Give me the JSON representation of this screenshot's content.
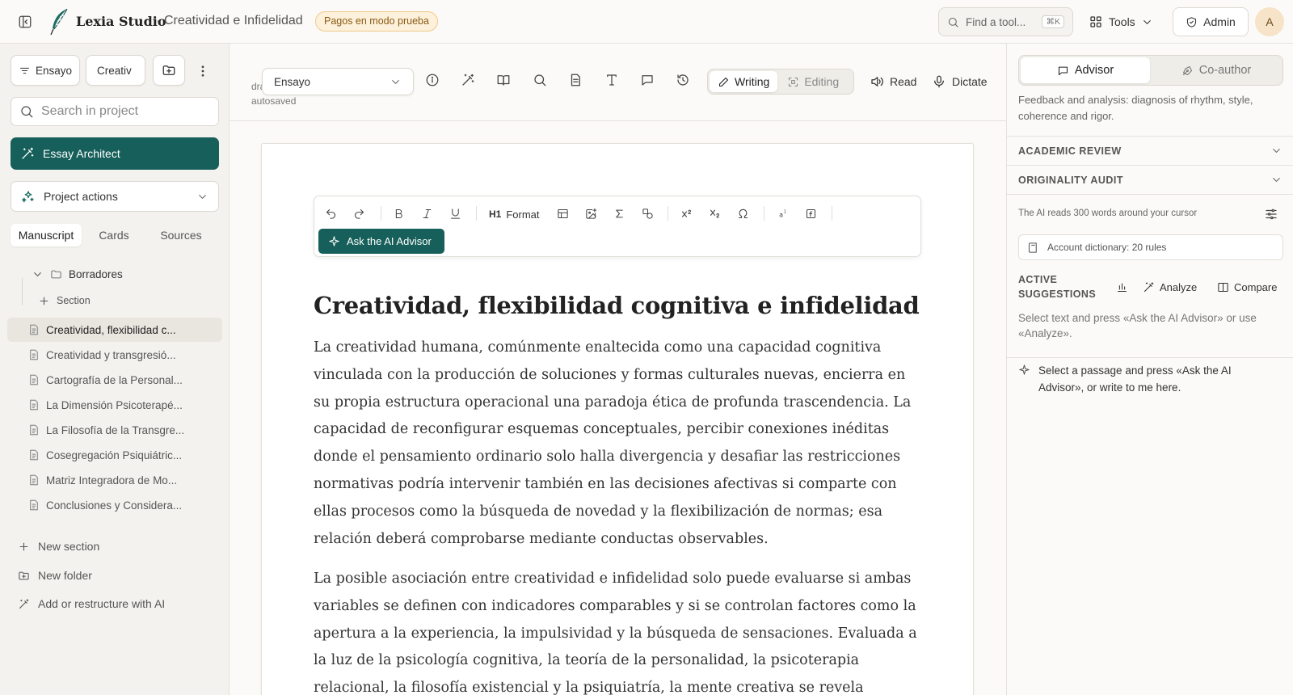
{
  "header": {
    "app_name": "Lexia Studio",
    "separator": "·",
    "document_name": "Creatividad e Infidelidad",
    "mode_badge": "Pagos en modo prueba",
    "find_tool_placeholder": "Find a tool...",
    "find_tool_shortcut": "⌘K",
    "tools_label": "Tools",
    "admin_label": "Admin",
    "avatar_initial": "A"
  },
  "sidebar": {
    "type_pill": "Ensayo",
    "doc_pill": "Creativ",
    "search_placeholder": "Search in project",
    "essay_architect": "Essay Architect",
    "project_actions": "Project actions",
    "tabs": [
      "Manuscript",
      "Cards",
      "Sources"
    ],
    "folder_name": "Borradores",
    "add_section_inline": "Section",
    "files": [
      "Creatividad, flexibilidad c...",
      "Creatividad y transgresió...",
      "Cartografía de la Personal...",
      "La Dimensión Psicoterapé...",
      "La Filosofía de la Transgre...",
      "Cosegregación Psiquiátric...",
      "Matriz Integradora de Mo...",
      "Conclusiones y Considera..."
    ],
    "new_section": "New section",
    "new_folder": "New folder",
    "add_with_ai": "Add or restructure with AI"
  },
  "toolbar": {
    "draft_line1": "draft",
    "draft_line2": "autosaved",
    "doc_type": "Ensayo",
    "writing": "Writing",
    "editing": "Editing",
    "read": "Read",
    "dictate": "Dictate"
  },
  "format_bar": {
    "format_label": "Format",
    "heading_glyph": "H1",
    "ask_advisor": "Ask the AI Advisor"
  },
  "document": {
    "title": "Creatividad, flexibilidad cognitiva e infidelidad",
    "paragraphs": [
      "La creatividad humana, comúnmente enaltecida como una capacidad cognitiva vinculada con la producción de soluciones y formas culturales nuevas, encierra en su propia estructura operacional una paradoja ética de profunda trascendencia. La capacidad de reconfigurar esquemas conceptuales, percibir conexiones inéditas donde el pensamiento ordinario solo halla divergencia y desafiar las restricciones normativas podría intervenir también en las decisiones afectivas si comparte con ellas procesos como la búsqueda de novedad y la flexibilización de normas; esa relación deberá comprobarse mediante conductas observables.",
      "La posible asociación entre creatividad e infidelidad solo puede evaluarse si ambas variables se definen con indicadores comparables y si se controlan factores como la apertura a la experiencia, la impulsividad y la búsqueda de sensaciones. Evaluada a la luz de la psicología cognitiva, la teoría de la personalidad, la psicoterapia relacional, la filosofía existencial y la psiquiatría, la mente creativa se revela poseedora de una..."
    ]
  },
  "right_panel": {
    "tab_advisor": "Advisor",
    "tab_coauthor": "Co-author",
    "description": "Feedback and analysis: diagnosis of rhythm, style, coherence and rigor.",
    "section_academic": "ACADEMIC REVIEW",
    "section_originality": "ORIGINALITY AUDIT",
    "ai_reads": "The AI reads 300 words around your cursor",
    "dictionary": "Account dictionary: 20 rules",
    "active_suggestions_line1": "ACTIVE",
    "active_suggestions_line2": "SUGGESTIONS",
    "analyze": "Analyze",
    "compare": "Compare",
    "suggestion_hint": "Select text and press «Ask the AI Advisor» or use «Analyze».",
    "chat_hint": "Select a passage and press «Ask the AI Advisor», or write to me here."
  },
  "colors": {
    "accent": "#165f5a",
    "badge_bg": "#fdf1dc",
    "badge_text": "#8a5a12",
    "avatar_bg": "#f7e3c7"
  },
  "icons": {
    "sidebar_toggle": "sidebar-toggle-icon",
    "logo": "quill-feather-icon",
    "find": "search-icon",
    "tools": "grid-icon",
    "admin": "shield-icon"
  }
}
